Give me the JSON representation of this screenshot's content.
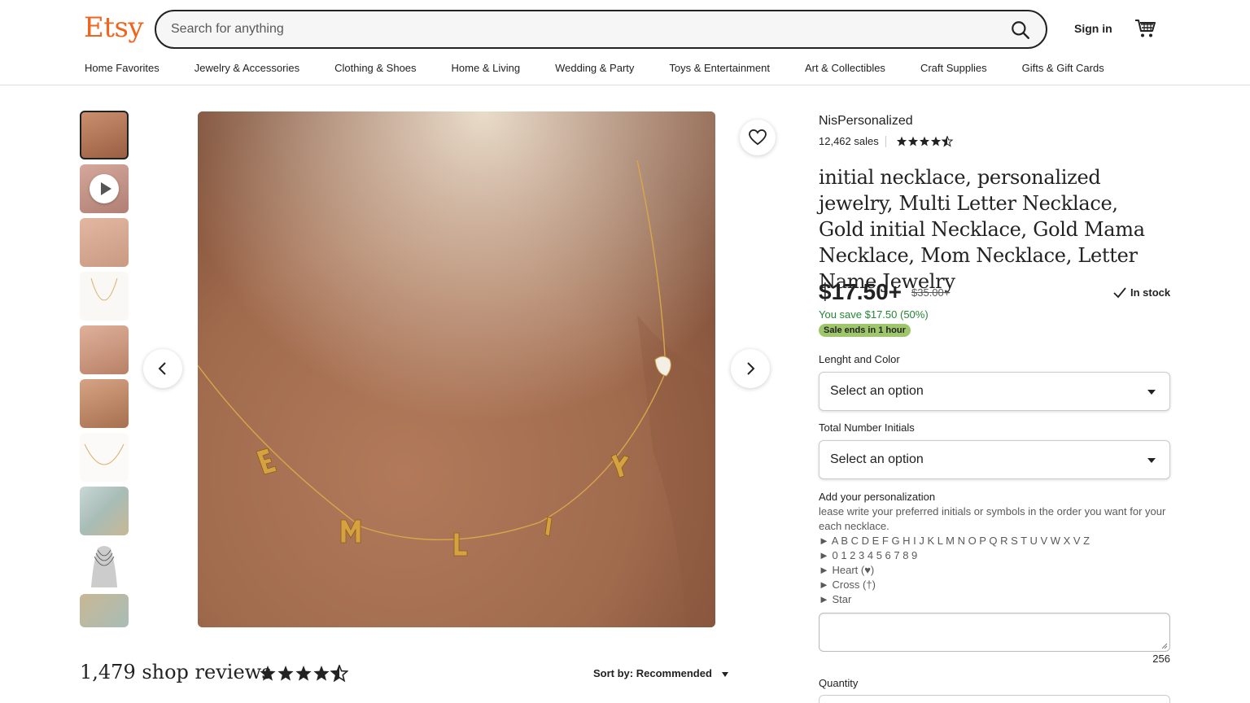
{
  "header": {
    "logo": "Etsy",
    "search_placeholder": "Search for anything",
    "sign_in": "Sign in",
    "nav": [
      "Home Favorites",
      "Jewelry & Accessories",
      "Clothing & Shoes",
      "Home & Living",
      "Wedding & Party",
      "Toys & Entertainment",
      "Art & Collectibles",
      "Craft Supplies",
      "Gifts & Gift Cards"
    ]
  },
  "gallery": {
    "thumbnail_count": 10,
    "video_thumbnail_index": 1,
    "main_image_alt": "EMLIY"
  },
  "listing": {
    "shop_name": "NisPersonalized",
    "sales": "12,462 sales",
    "shop_rating": 4.5,
    "title": "initial necklace, personalized jewelry, Multi Letter Necklace, Gold initial Necklace, Gold Mama Necklace, Mom Necklace, Letter Name Jewelry",
    "price": "$17.50+",
    "original_price": "$35.00+",
    "stock": "In stock",
    "savings": "You save $17.50 (50%)",
    "sale_badge": "Sale ends in 1 hour"
  },
  "options": {
    "length_label": "Lenght and Color",
    "length_value": "Select an option",
    "initials_label": "Total Number Initials",
    "initials_value": "Select an option"
  },
  "personalization": {
    "label": "Add your personalization",
    "lines": [
      "lease write your preferred initials or symbols in the order you want for your each necklace.",
      "► A B C D E F G H I J K L M N O P Q R S T U V W X V Z",
      "► 0 1 2 3 4 5 6 7 8 9",
      "► Heart (♥)",
      "► Cross (†)",
      "► Star"
    ],
    "char_count": "256"
  },
  "quantity_label": "Quantity",
  "reviews": {
    "title": "1,479 shop reviews",
    "rating": 4.5,
    "sort_label": "Sort by: Recommended"
  },
  "colors": {
    "brand": "#f1641e",
    "sale_text": "#258635",
    "sale_badge": "#9ec76b"
  }
}
